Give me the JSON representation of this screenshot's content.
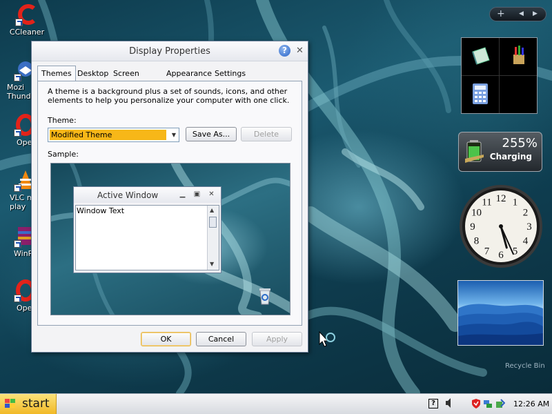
{
  "desktop": {
    "icons": [
      {
        "label": "CCleaner"
      },
      {
        "label": "Mozi\nThunde"
      },
      {
        "label": "Ope"
      },
      {
        "label": "VLC m\nplay"
      },
      {
        "label": "WinR"
      },
      {
        "label": "Ope"
      }
    ],
    "recycle_bin_label": "Recycle Bin"
  },
  "dialog": {
    "title": "Display Properties",
    "help_glyph": "?",
    "close_glyph": "✕",
    "tabs": [
      {
        "label": "Themes",
        "active": true
      },
      {
        "label": "Desktop"
      },
      {
        "label": "Screen Saver"
      },
      {
        "label": "Appearance"
      },
      {
        "label": "Settings"
      }
    ],
    "description": "A theme is a background plus a set of sounds, icons, and other elements to help you personalize your computer with one click.",
    "theme_label": "Theme:",
    "theme_value": "Modified Theme",
    "save_as_label": "Save As...",
    "delete_label": "Delete",
    "sample_label": "Sample:",
    "sample": {
      "window_title": "Active Window",
      "window_text": "Window Text"
    },
    "ok_label": "OK",
    "cancel_label": "Cancel",
    "apply_label": "Apply"
  },
  "sidebar": {
    "add_glyph": "+",
    "prev_glyph": "◀",
    "next_glyph": "▶",
    "battery_percent": "255%",
    "battery_state": "Charging",
    "clock_numbers": [
      "12",
      "1",
      "2",
      "3",
      "4",
      "5",
      "6",
      "7",
      "8",
      "9",
      "10",
      "11"
    ],
    "clock_hour_hand_angle_deg": 165,
    "clock_minute_hand_angle_deg": 156
  },
  "taskbar": {
    "start_label": "start",
    "time": "12:26 AM",
    "tray_icons": [
      "help-icon",
      "speaker-icon",
      "shield-icon",
      "network-icon",
      "update-icon"
    ]
  },
  "colors": {
    "start_button": "#f1b927",
    "selection": "#f7b718",
    "desktop_bg": "#1b5a70"
  }
}
